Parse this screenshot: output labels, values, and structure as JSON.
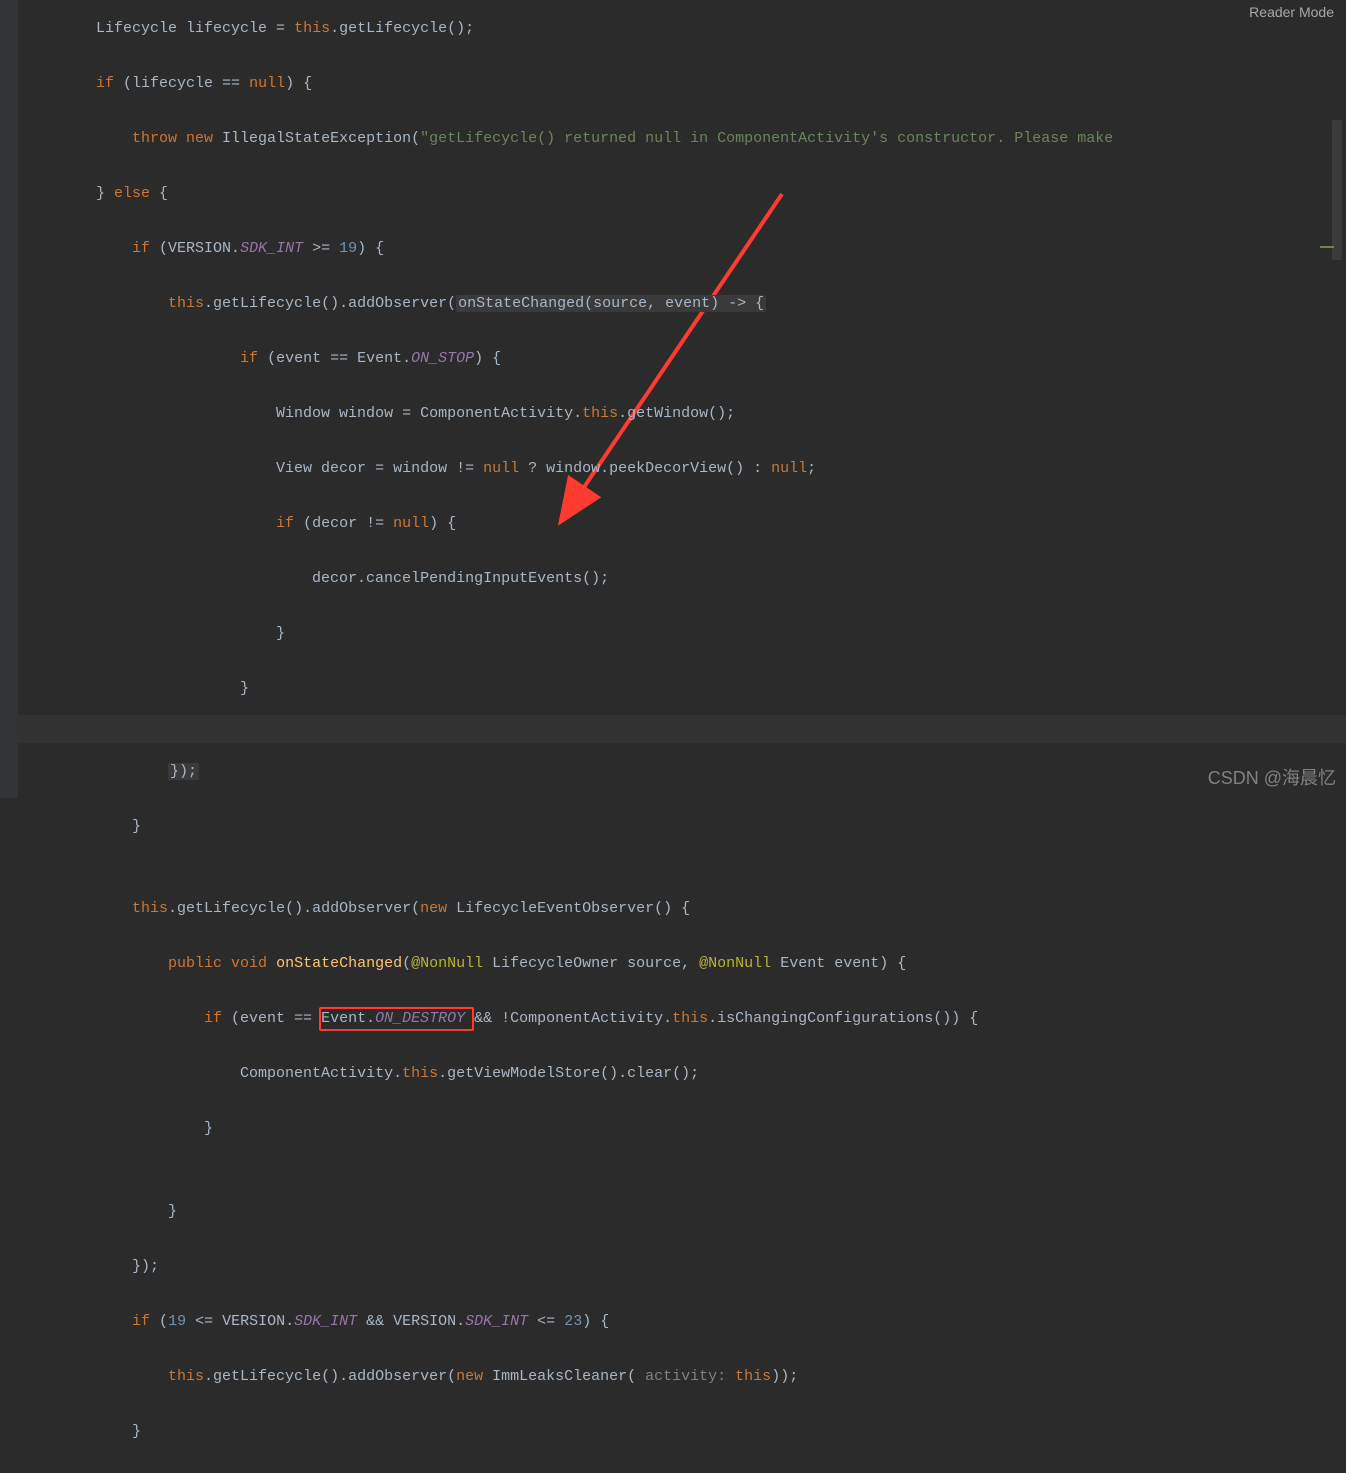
{
  "editor": {
    "reader_mode_label": "Reader Mode",
    "watermark": "CSDN @海晨忆"
  },
  "highlighted_token": "Event.ON_DESTROY",
  "code": {
    "lines": [
      {
        "indent": 8,
        "tokens": [
          {
            "t": "Lifecycle lifecycle = ",
            "c": "c-def"
          },
          {
            "t": "this",
            "c": "c-kw"
          },
          {
            "t": ".getLifecycle();",
            "c": "c-def"
          }
        ]
      },
      {
        "indent": 8,
        "tokens": [
          {
            "t": "if ",
            "c": "c-kw"
          },
          {
            "t": "(lifecycle == ",
            "c": "c-def"
          },
          {
            "t": "null",
            "c": "c-kw"
          },
          {
            "t": ") {",
            "c": "c-def"
          }
        ]
      },
      {
        "indent": 12,
        "tokens": [
          {
            "t": "throw new ",
            "c": "c-kw"
          },
          {
            "t": "IllegalStateException(",
            "c": "c-def"
          },
          {
            "t": "\"getLifecycle() returned null in ComponentActivity's constructor. Please make ",
            "c": "c-str"
          }
        ]
      },
      {
        "indent": 8,
        "tokens": [
          {
            "t": "} ",
            "c": "c-def"
          },
          {
            "t": "else ",
            "c": "c-kw"
          },
          {
            "t": "{",
            "c": "c-def"
          }
        ]
      },
      {
        "indent": 12,
        "tokens": [
          {
            "t": "if ",
            "c": "c-kw"
          },
          {
            "t": "(VERSION.",
            "c": "c-def"
          },
          {
            "t": "SDK_INT",
            "c": "c-static-i"
          },
          {
            "t": " >= ",
            "c": "c-def"
          },
          {
            "t": "19",
            "c": "c-num"
          },
          {
            "t": ") {",
            "c": "c-def"
          }
        ]
      },
      {
        "indent": 16,
        "tokens": [
          {
            "t": "this",
            "c": "c-kw"
          },
          {
            "t": ".getLifecycle().addObserver(",
            "c": "c-def"
          },
          {
            "t": "onStateChanged(source, event) -> {",
            "c": "c-def",
            "bg": "lambda-bg"
          }
        ]
      },
      {
        "indent": 24,
        "tokens": [
          {
            "t": "if ",
            "c": "c-kw"
          },
          {
            "t": "(event == Event.",
            "c": "c-def"
          },
          {
            "t": "ON_STOP",
            "c": "c-static-i"
          },
          {
            "t": ") {",
            "c": "c-def"
          }
        ]
      },
      {
        "indent": 28,
        "tokens": [
          {
            "t": "Window window = ComponentActivity.",
            "c": "c-def"
          },
          {
            "t": "this",
            "c": "c-kw"
          },
          {
            "t": ".getWindow();",
            "c": "c-def"
          }
        ]
      },
      {
        "indent": 28,
        "tokens": [
          {
            "t": "View decor = window != ",
            "c": "c-def"
          },
          {
            "t": "null ",
            "c": "c-kw"
          },
          {
            "t": "? window.peekDecorView() : ",
            "c": "c-def"
          },
          {
            "t": "null",
            "c": "c-kw"
          },
          {
            "t": ";",
            "c": "c-def"
          }
        ]
      },
      {
        "indent": 28,
        "tokens": [
          {
            "t": "if ",
            "c": "c-kw"
          },
          {
            "t": "(decor != ",
            "c": "c-def"
          },
          {
            "t": "null",
            "c": "c-kw"
          },
          {
            "t": ") {",
            "c": "c-def"
          }
        ]
      },
      {
        "indent": 32,
        "tokens": [
          {
            "t": "decor.cancelPendingInputEvents();",
            "c": "c-def"
          }
        ]
      },
      {
        "indent": 28,
        "tokens": [
          {
            "t": "}",
            "c": "c-def"
          }
        ]
      },
      {
        "indent": 24,
        "tokens": [
          {
            "t": "}",
            "c": "c-def"
          }
        ]
      },
      {
        "indent": 0,
        "tokens": [
          {
            "t": "",
            "c": "c-def"
          }
        ]
      },
      {
        "indent": 16,
        "tokens": [
          {
            "t": "});",
            "c": "c-def",
            "bg": "lambda-bg"
          }
        ]
      },
      {
        "indent": 12,
        "tokens": [
          {
            "t": "}",
            "c": "c-def"
          }
        ]
      },
      {
        "indent": 0,
        "tokens": [
          {
            "t": "",
            "c": "c-def"
          }
        ]
      },
      {
        "indent": 12,
        "tokens": [
          {
            "t": "this",
            "c": "c-kw"
          },
          {
            "t": ".getLifecycle().addObserver(",
            "c": "c-def"
          },
          {
            "t": "new ",
            "c": "c-kw"
          },
          {
            "t": "LifecycleEventObserver() {",
            "c": "c-def"
          }
        ]
      },
      {
        "indent": 16,
        "tokens": [
          {
            "t": "public void ",
            "c": "c-kw"
          },
          {
            "t": "onStateChanged",
            "c": "c-fn"
          },
          {
            "t": "(",
            "c": "c-def"
          },
          {
            "t": "@NonNull",
            "c": "c-ann"
          },
          {
            "t": " LifecycleOwner source, ",
            "c": "c-def"
          },
          {
            "t": "@NonNull",
            "c": "c-ann"
          },
          {
            "t": " Event event) {",
            "c": "c-def"
          }
        ]
      },
      {
        "indent": 20,
        "tokens": [
          {
            "t": "if ",
            "c": "c-kw"
          },
          {
            "t": "(event == ",
            "c": "c-def"
          },
          {
            "t": "Event.",
            "c": "c-def",
            "box": true
          },
          {
            "t": "ON_DESTROY",
            "c": "c-static-i",
            "box": true
          },
          {
            "t": " && !ComponentActivity.",
            "c": "c-def"
          },
          {
            "t": "this",
            "c": "c-kw"
          },
          {
            "t": ".isChangingConfigurations()) {",
            "c": "c-def"
          }
        ]
      },
      {
        "indent": 24,
        "tokens": [
          {
            "t": "ComponentActivity.",
            "c": "c-def"
          },
          {
            "t": "this",
            "c": "c-kw"
          },
          {
            "t": ".getViewModelStore().clear();",
            "c": "c-def"
          }
        ]
      },
      {
        "indent": 20,
        "tokens": [
          {
            "t": "}",
            "c": "c-def"
          }
        ]
      },
      {
        "indent": 0,
        "tokens": [
          {
            "t": "",
            "c": "c-def"
          }
        ]
      },
      {
        "indent": 16,
        "tokens": [
          {
            "t": "}",
            "c": "c-def"
          }
        ]
      },
      {
        "indent": 12,
        "tokens": [
          {
            "t": "});",
            "c": "c-def"
          }
        ]
      },
      {
        "indent": 12,
        "tokens": [
          {
            "t": "if ",
            "c": "c-kw"
          },
          {
            "t": "(",
            "c": "c-def"
          },
          {
            "t": "19",
            "c": "c-num"
          },
          {
            "t": " <= VERSION.",
            "c": "c-def"
          },
          {
            "t": "SDK_INT",
            "c": "c-static-i"
          },
          {
            "t": " && VERSION.",
            "c": "c-def"
          },
          {
            "t": "SDK_INT",
            "c": "c-static-i"
          },
          {
            "t": " <= ",
            "c": "c-def"
          },
          {
            "t": "23",
            "c": "c-num"
          },
          {
            "t": ") {",
            "c": "c-def"
          }
        ]
      },
      {
        "indent": 16,
        "tokens": [
          {
            "t": "this",
            "c": "c-kw"
          },
          {
            "t": ".getLifecycle().addObserver(",
            "c": "c-def"
          },
          {
            "t": "new ",
            "c": "c-kw"
          },
          {
            "t": "ImmLeaksCleaner(",
            "c": "c-def"
          },
          {
            "t": " activity: ",
            "c": "c-param"
          },
          {
            "t": "this",
            "c": "c-kw"
          },
          {
            "t": "));",
            "c": "c-def"
          }
        ]
      },
      {
        "indent": 12,
        "tokens": [
          {
            "t": "}",
            "c": "c-def"
          }
        ]
      }
    ]
  }
}
